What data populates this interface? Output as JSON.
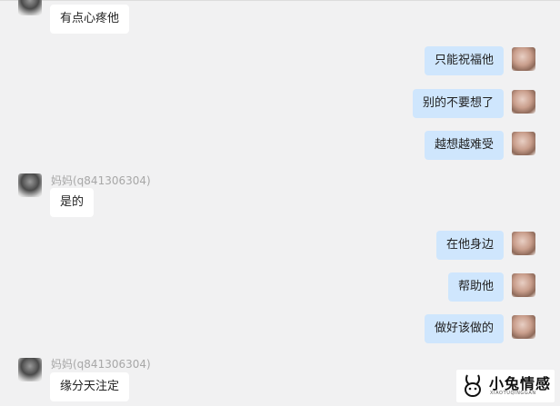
{
  "contact": {
    "sender_name": "妈妈(q841306304)"
  },
  "messages": [
    {
      "side": "left",
      "text": "有点心疼他"
    },
    {
      "side": "right",
      "text": "只能祝福他"
    },
    {
      "side": "right",
      "text": "别的不要想了"
    },
    {
      "side": "right",
      "text": "越想越难受"
    },
    {
      "side": "left",
      "sender": "妈妈(q841306304)",
      "text": "是的"
    },
    {
      "side": "right",
      "text": "在他身边"
    },
    {
      "side": "right",
      "text": "帮助他"
    },
    {
      "side": "right",
      "text": "做好该做的"
    },
    {
      "side": "left",
      "sender": "妈妈(q841306304)",
      "text": "缘分天注定"
    }
  ],
  "watermark": {
    "title": "小兔情感",
    "subtitle": "XIAOTUQINGGAN"
  },
  "colors": {
    "background": "#f1f1f2",
    "own_bubble": "#cfe6fd",
    "other_bubble": "#ffffff",
    "sender_name": "#a7a7a7"
  }
}
